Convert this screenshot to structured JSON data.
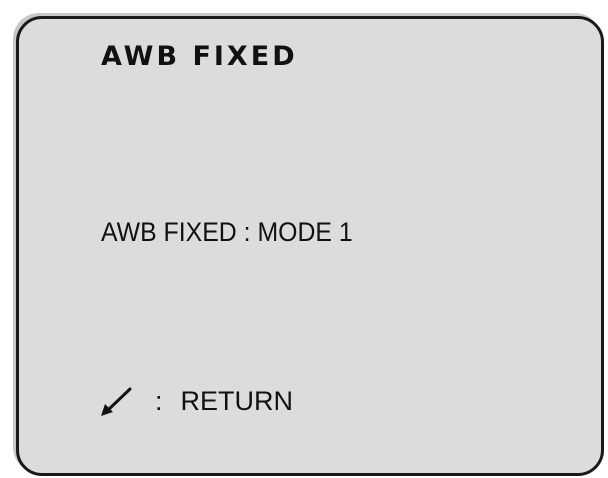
{
  "menu": {
    "title": "AWB FIXED",
    "setting": {
      "label": "AWB FIXED",
      "separator": ":",
      "value": "MODE 1"
    },
    "footer": {
      "icon": "return-arrow-icon",
      "separator": ":",
      "label": "RETURN"
    }
  },
  "colors": {
    "screen_background": "#dcdcdc",
    "border": "#1a1a1a",
    "text": "#111111"
  }
}
